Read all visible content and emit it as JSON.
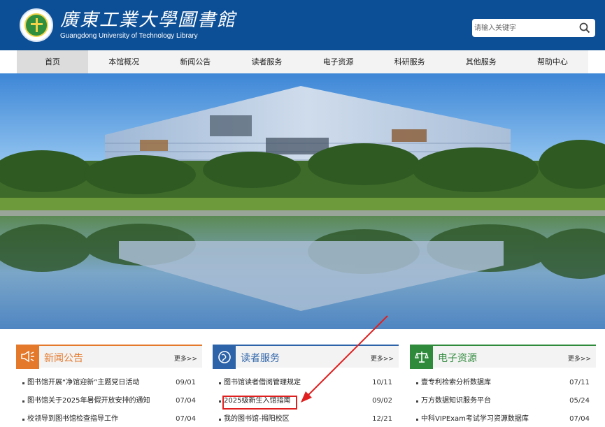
{
  "header": {
    "logo_cn": "廣東工業大學圖書館",
    "logo_en": "Guangdong University of Technology Library",
    "search_placeholder": "请输入关键字"
  },
  "nav": [
    "首页",
    "本馆概况",
    "新闻公告",
    "读者服务",
    "电子资源",
    "科研服务",
    "其他服务",
    "帮助中心"
  ],
  "panels": {
    "news": {
      "title": "新闻公告",
      "more": "更多>>",
      "items": [
        {
          "text": "图书馆开展“净馆迎新”主题党日活动",
          "date": "09/01"
        },
        {
          "text": "图书馆关于2025年暑假开放安排的通知",
          "date": "07/04"
        },
        {
          "text": "校领导到图书馆检查指导工作",
          "date": "07/04"
        }
      ]
    },
    "reader": {
      "title": "读者服务",
      "more": "更多>>",
      "items": [
        {
          "text": "图书馆读者借阅管理规定",
          "date": "10/11"
        },
        {
          "text": "2025级新生入馆指南",
          "date": "09/02"
        },
        {
          "text": "我的图书馆-揭阳校区",
          "date": "12/21"
        }
      ]
    },
    "eres": {
      "title": "电子资源",
      "more": "更多>>",
      "items": [
        {
          "text": "壹专利检索分析数据库",
          "date": "07/11"
        },
        {
          "text": "万方数据知识服务平台",
          "date": "05/24"
        },
        {
          "text": "中科VIPExam考试学习资源数据库",
          "date": "07/04"
        }
      ]
    }
  },
  "colors": {
    "header": "#0d4f96",
    "news_accent": "#e4782b",
    "reader_accent": "#2d63a8",
    "eres_accent": "#2f8a3c",
    "annotation": "#e02020"
  }
}
